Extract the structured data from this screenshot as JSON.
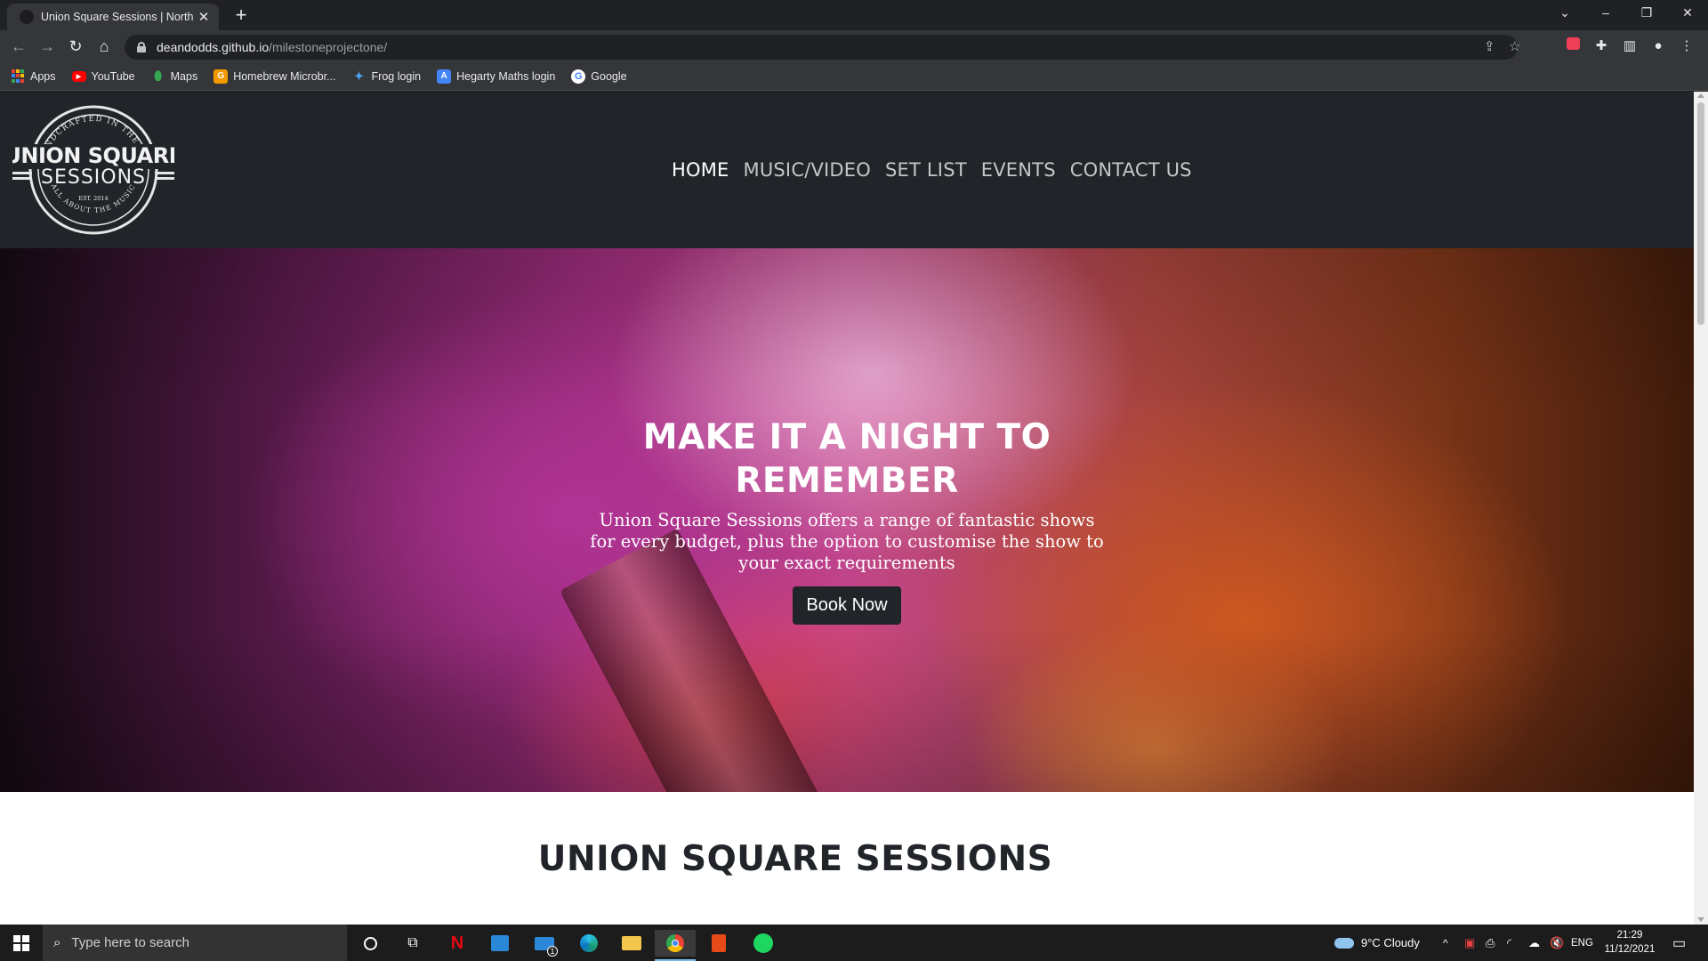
{
  "browser": {
    "tab_title": "Union Square Sessions | North Ea",
    "url_host": "deandodds.github.io",
    "url_path": "/milestoneprojectone/",
    "bookmarks": [
      {
        "label": "Apps",
        "icon": "apps-grid-icon",
        "color": "#e94235"
      },
      {
        "label": "YouTube",
        "icon": "youtube-icon",
        "color": "#ff0000"
      },
      {
        "label": "Maps",
        "icon": "maps-pin-icon",
        "color": "#34a853"
      },
      {
        "label": "Homebrew Microbr...",
        "icon": "homebrew-g-icon",
        "color": "#f29900"
      },
      {
        "label": "Frog login",
        "icon": "frog-icon",
        "color": "#1e88e5"
      },
      {
        "label": "Hegarty Maths login",
        "icon": "hegarty-icon",
        "color": "#4285f4"
      },
      {
        "label": "Google",
        "icon": "google-icon",
        "color": "#ffffff"
      }
    ]
  },
  "site": {
    "logo": {
      "arc_top": "HANDCRAFTED IN THE UK",
      "line1": "UNION SQUARE",
      "line2": "SESSIONS",
      "est": "EST. 2014",
      "arc_bottom": "ALL ABOUT THE MUSIC"
    },
    "nav": [
      "HOME",
      "MUSIC/VIDEO",
      "SET LIST",
      "EVENTS",
      "CONTACT US"
    ],
    "hero": {
      "title_line1": "MAKE IT A NIGHT TO",
      "title_line2": "REMEMBER",
      "subtitle": "Union Square Sessions offers a range of fantastic shows for every budget, plus the option to customise the show to your exact requirements",
      "button": "Book Now"
    },
    "section_title": "UNION SQUARE SESSIONS"
  },
  "taskbar": {
    "search_placeholder": "Type here to search",
    "weather": "9°C  Cloudy",
    "language": "ENG",
    "time": "21:29",
    "date": "11/12/2021",
    "mail_badge": "1"
  }
}
